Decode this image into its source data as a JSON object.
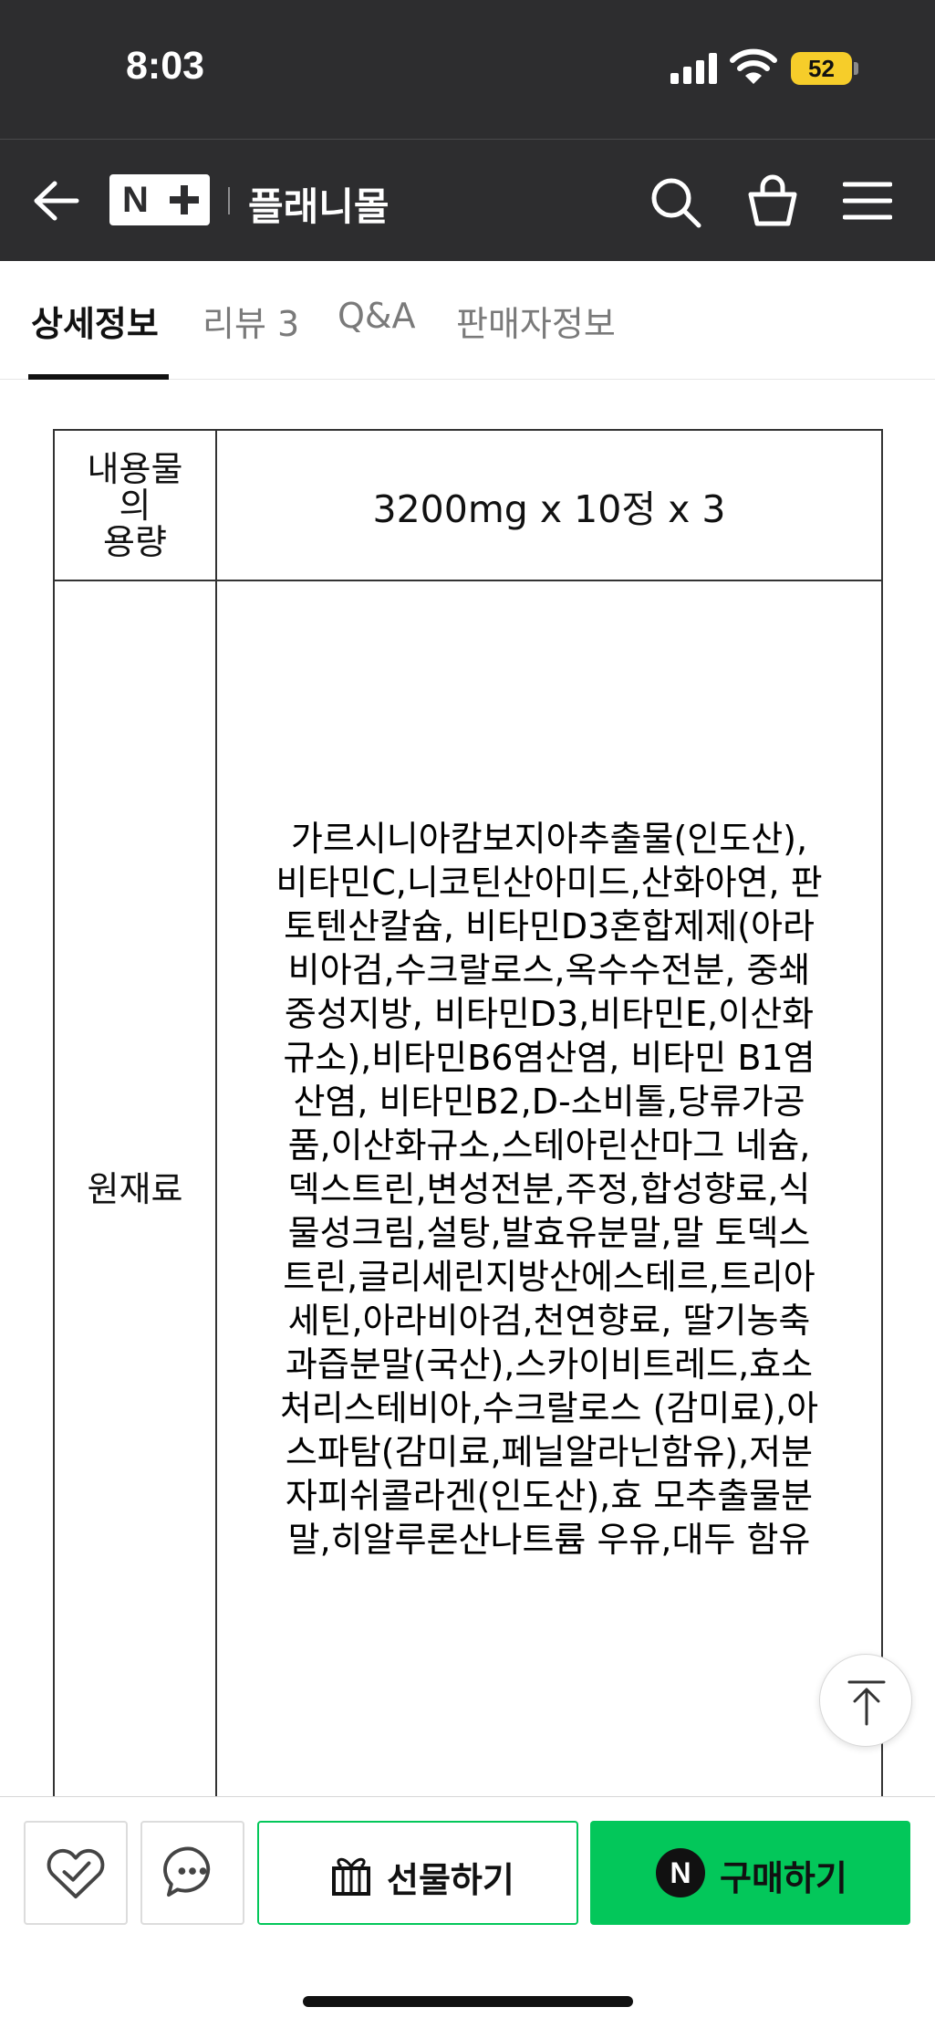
{
  "status_bar": {
    "time": "8:03",
    "battery": "52"
  },
  "header": {
    "store_name": "플래니몰",
    "logo_text": "N"
  },
  "tabs": [
    {
      "label": "상세정보",
      "active": true
    },
    {
      "label": "리뷰 3",
      "active": false
    },
    {
      "label": "Q&A",
      "active": false
    },
    {
      "label": "판매자정보",
      "active": false
    }
  ],
  "spec_table": {
    "rows": [
      {
        "header_lines": [
          "내용물",
          "의",
          "용량"
        ],
        "value": "3200mg x 10정 x 3"
      },
      {
        "header": "원재료",
        "value_lines": [
          "가르시니아캄보지아추출물(인도산),",
          "비타민C,니코틴산아미드,산화아연, 판",
          "토텐산칼슘, 비타민D3혼합제제(아라",
          "비아검,수크랄로스,옥수수전분, 중쇄",
          "중성지방, 비타민D3,비타민E,이산화",
          "규소),비타민B6염산염, 비타민 B1염",
          "산염, 비타민B2,D-소비톨,당류가공",
          "품,이산화규소,스테아린산마그 네슘,",
          "덱스트린,변성전분,주정,합성향료,식",
          "물성크림,설탕,발효유분말,말 토덱스",
          "트린,글리세린지방산에스테르,트리아",
          "세틴,아라비아검,천연향료, 딸기농축",
          "과즙분말(국산),스카이비트레드,효소",
          "처리스테비아,수크랄로스 (감미료),아",
          "스파탐(감미료,페닐알라닌함유),저분",
          "자피쉬콜라겐(인도산),효 모추출물분",
          "말,히알루론산나트륨 우유,대두 함유"
        ]
      }
    ]
  },
  "bottom_bar": {
    "gift_label": "선물하기",
    "buy_label": "구매하기",
    "npay_badge": "N",
    "accent_color": "#03c75a"
  },
  "icons": [
    "back-icon",
    "search-icon",
    "cart-icon",
    "menu-icon",
    "heart-check-icon",
    "chat-icon",
    "gift-icon",
    "arrow-up-icon"
  ]
}
